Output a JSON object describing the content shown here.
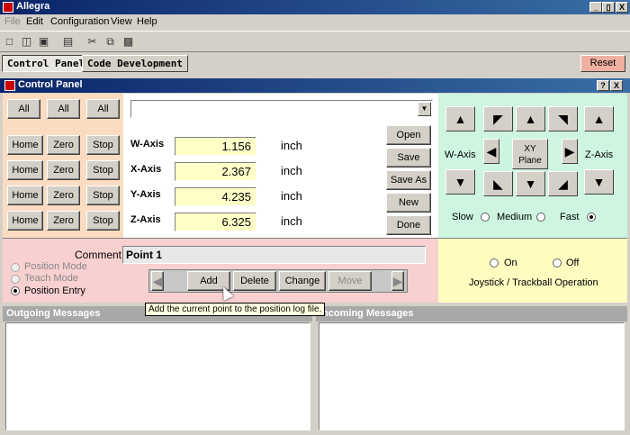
{
  "window": {
    "title": "Allegra",
    "min": "_",
    "max": "▯",
    "close": "X"
  },
  "menu": [
    "File",
    "Edit",
    "Configuration",
    "View",
    "Help"
  ],
  "tabs": {
    "control_panel": "Control Panel",
    "code_development": "Code Development",
    "reset": "Reset"
  },
  "control_panel": {
    "title": "Control Panel",
    "help": "?",
    "close": "X"
  },
  "all_buttons": [
    "All",
    "All",
    "All"
  ],
  "axis_rows": [
    {
      "home": "Home",
      "zero": "Zero",
      "stop": "Stop",
      "label": "W-Axis",
      "value": "1.156",
      "unit": "inch"
    },
    {
      "home": "Home",
      "zero": "Zero",
      "stop": "Stop",
      "label": "X-Axis",
      "value": "2.367",
      "unit": "inch"
    },
    {
      "home": "Home",
      "zero": "Zero",
      "stop": "Stop",
      "label": "Y-Axis",
      "value": "4.235",
      "unit": "inch"
    },
    {
      "home": "Home",
      "zero": "Zero",
      "stop": "Stop",
      "label": "Z-Axis",
      "value": "6.325",
      "unit": "inch"
    }
  ],
  "file_buttons": {
    "open": "Open",
    "save": "Save",
    "save_as": "Save As",
    "new": "New",
    "done": "Done"
  },
  "jog": {
    "w_axis": "W-Axis",
    "z_axis": "Z-Axis",
    "xy_plane": "XY Plane",
    "slow": "Slow",
    "medium": "Medium",
    "fast": "Fast",
    "speed_selected": "fast"
  },
  "position": {
    "comment_label": "Comment",
    "comment_value": "Point 1",
    "modes": [
      "Position Mode",
      "Teach Mode",
      "Position Entry"
    ],
    "selected_mode": "Position Entry",
    "add": "Add",
    "delete": "Delete",
    "change": "Change",
    "move": "Move"
  },
  "joystick": {
    "on": "On",
    "off": "Off",
    "label": "Joystick / Trackball Operation"
  },
  "messages": {
    "outgoing": "Outgoing Messages",
    "incoming": "Incoming Messages"
  },
  "tooltip": "Add the current point to the position log file."
}
